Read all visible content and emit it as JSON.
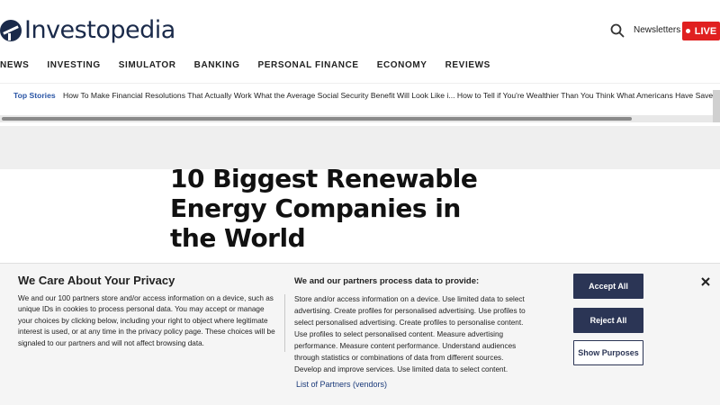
{
  "header": {
    "logo_text": "Investopedia",
    "newsletters_label": "Newsletters",
    "live_label": "LIVE"
  },
  "nav": {
    "items": [
      "NEWS",
      "INVESTING",
      "SIMULATOR",
      "BANKING",
      "PERSONAL FINANCE",
      "ECONOMY",
      "REVIEWS"
    ]
  },
  "top_stories": {
    "label": "Top Stories",
    "links": [
      "How To Make Financial Resolutions That Actually Work",
      "What the Average Social Security Benefit Will Look Like i...",
      "How to Tell if You're Wealthier Than You Think",
      "What Americans Have Saved for R"
    ]
  },
  "article": {
    "title": "10 Biggest Renewable Energy Companies in the World"
  },
  "privacy_banner": {
    "title": "We Care About Your Privacy",
    "body": "We and our 100 partners store and/or access information on a device, such as unique IDs in cookies to process personal data. You may accept or manage your choices by clicking below, including your right to object where legitimate interest is used, or at any time in the privacy policy page. These choices will be signaled to our partners and will not affect browsing data.",
    "purposes_title": "We and our partners process data to provide:",
    "purposes_body": "Store and/or access information on a device. Use limited data to select advertising. Create profiles for personalised advertising. Use profiles to select personalised advertising. Create profiles to personalise content. Use profiles to select personalised content. Measure advertising performance. Measure content performance. Understand audiences through statistics or combinations of data from different sources. Develop and improve services. Use limited data to select content.",
    "partners_link": "List of Partners (vendors)",
    "accept_label": "Accept All",
    "reject_label": "Reject All",
    "show_purposes_label": "Show Purposes"
  },
  "colors": {
    "brand_navy": "#1a2a4a",
    "live_red": "#e02020",
    "top_stories_blue": "#2a55a5",
    "button_navy": "#2b3555"
  },
  "icons": {
    "search": "search-icon",
    "close": "close-icon",
    "logo": "investopedia-logo-icon"
  }
}
